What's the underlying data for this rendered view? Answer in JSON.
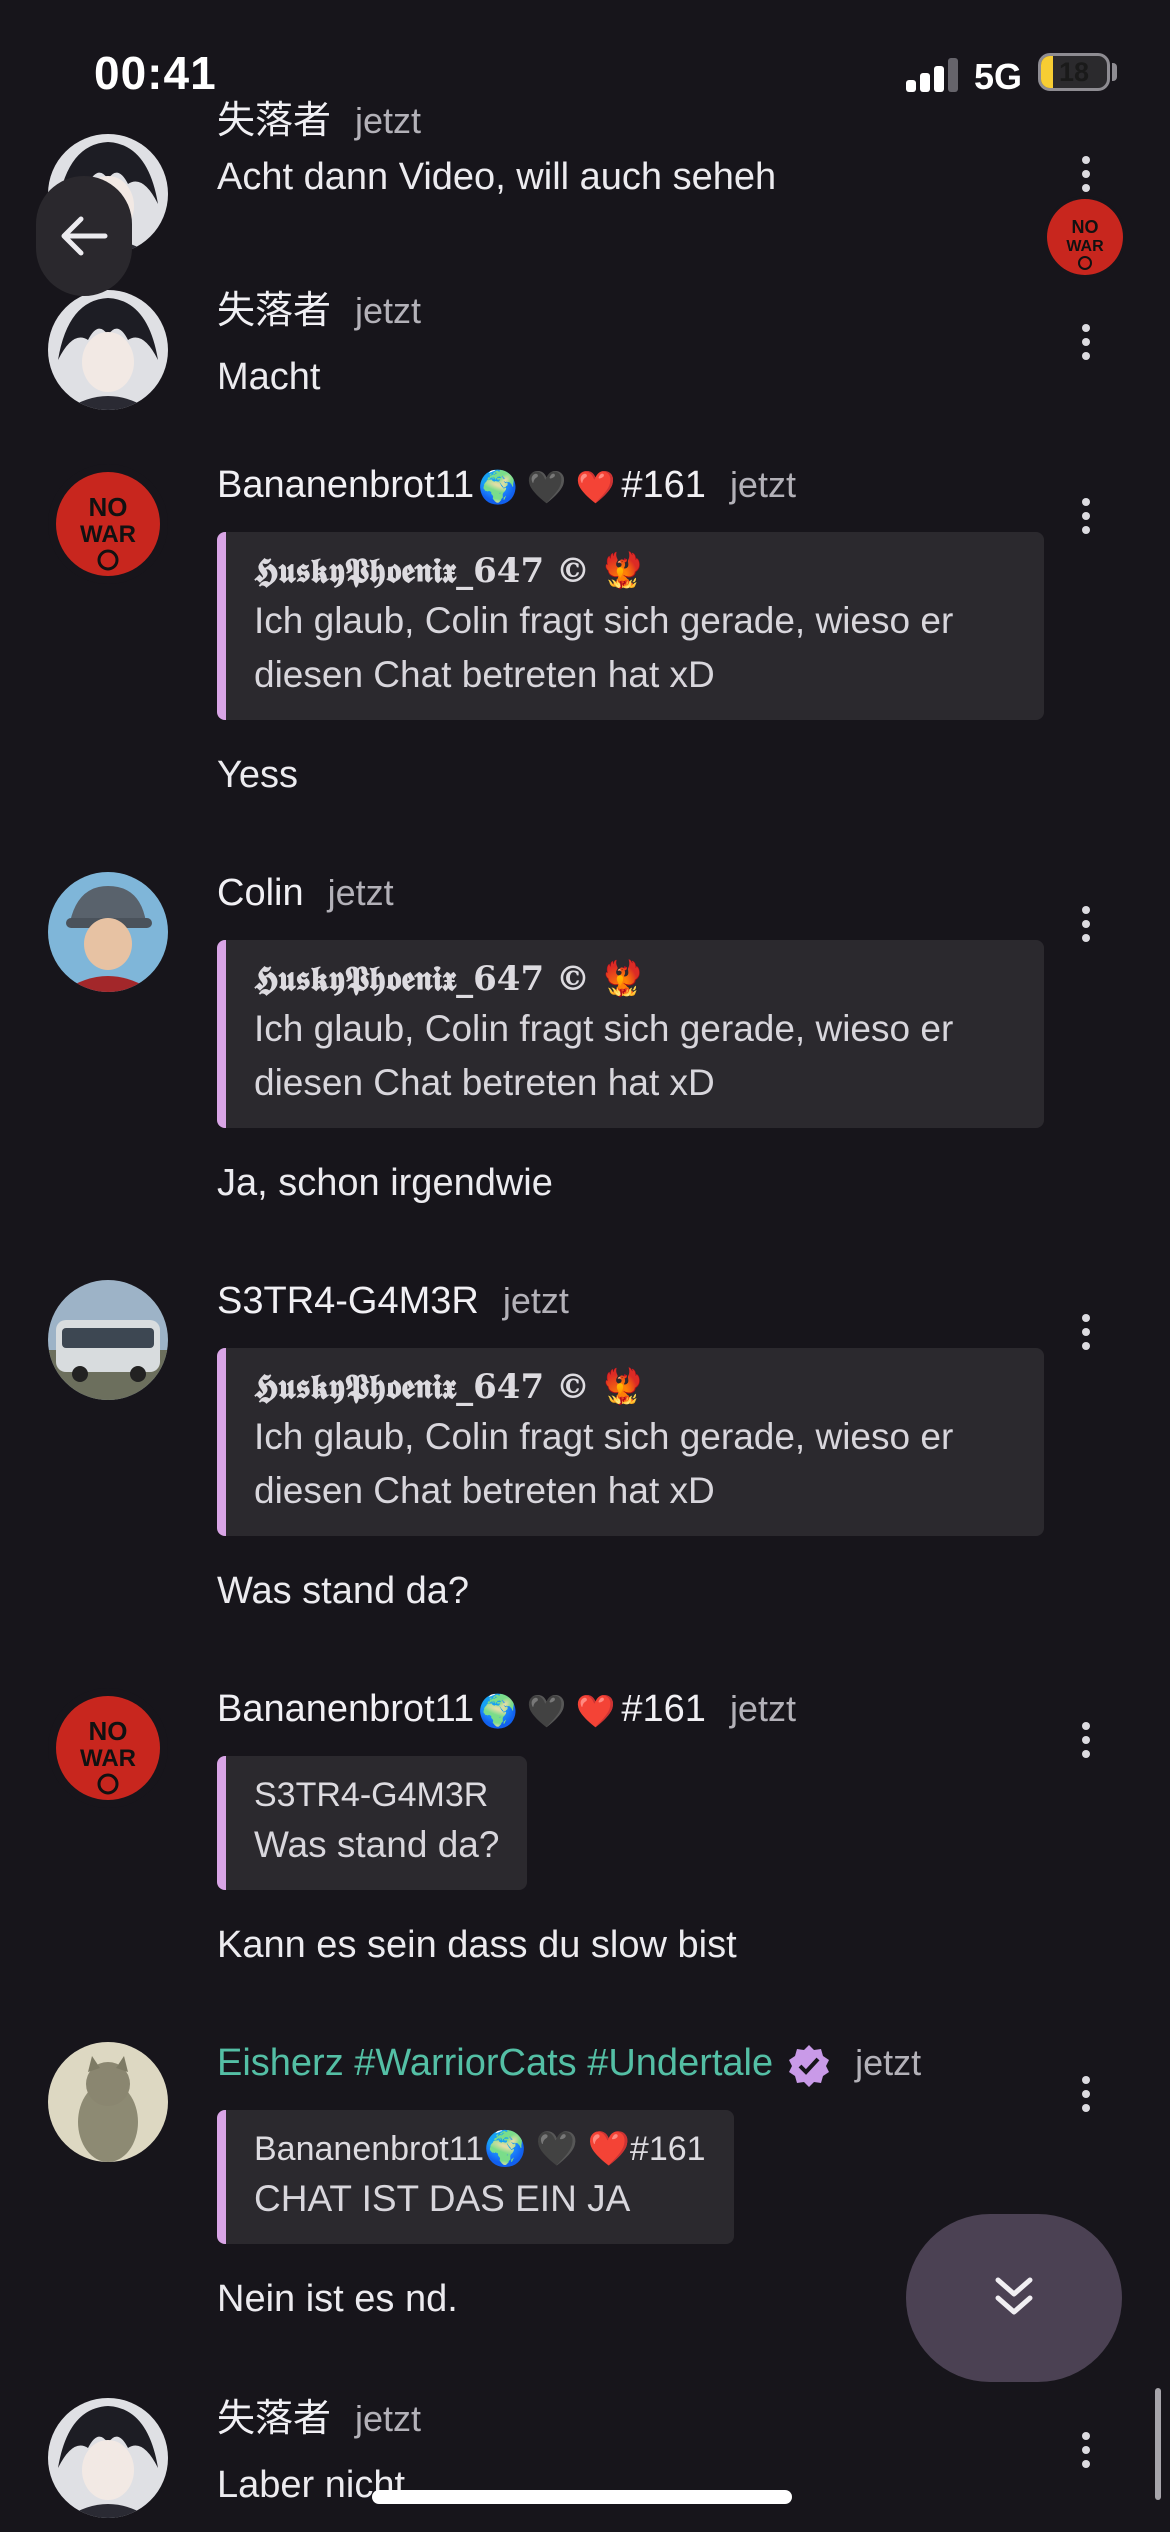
{
  "status_bar": {
    "time": "00:41",
    "network": "5G",
    "battery": "18",
    "battery_level": 0.18
  },
  "colors": {
    "background": "#17151b",
    "quote_bar": "#d9a5e6",
    "accent_name": "#54bfa5",
    "scroll_button": "#4b4153"
  },
  "icons": {
    "back": "arrow-left-icon",
    "menu": "more-vertical-icon",
    "scroll_down": "chevrons-down-icon",
    "verified": "verified-badge-icon"
  },
  "messages": [
    {
      "author": "失落者",
      "time": "jetzt",
      "text": "Acht dann Video, will auch seheh"
    },
    {
      "author": "失落者",
      "time": "jetzt",
      "text": "Macht"
    },
    {
      "author": "Bananenbrot11",
      "emojis": "🌍 🖤 ❤️",
      "tag": "#161",
      "time": "jetzt",
      "quote": {
        "author": "𝕳𝖚𝖘𝖐𝖞𝕻𝖍𝖔𝖊𝖓𝖎𝖝_647 © 🐦‍🔥",
        "text": "Ich glaub, Colin fragt sich gerade, wieso er diesen Chat betreten hat xD"
      },
      "text": "Yess"
    },
    {
      "author": "Colin",
      "time": "jetzt",
      "quote": {
        "author": "𝕳𝖚𝖘𝖐𝖞𝕻𝖍𝖔𝖊𝖓𝖎𝖝_647 © 🐦‍🔥",
        "text": "Ich glaub, Colin fragt sich gerade, wieso er diesen Chat betreten hat xD"
      },
      "text": "Ja, schon irgendwie"
    },
    {
      "author": "S3TR4-G4M3R",
      "time": "jetzt",
      "quote": {
        "author": "𝕳𝖚𝖘𝖐𝖞𝕻𝖍𝖔𝖊𝖓𝖎𝖝_647 © 🐦‍🔥",
        "text": "Ich glaub, Colin fragt sich gerade, wieso er diesen Chat betreten hat xD"
      },
      "text": "Was stand da?"
    },
    {
      "author": "Bananenbrot11",
      "emojis": "🌍 🖤 ❤️",
      "tag": "#161",
      "time": "jetzt",
      "quote": {
        "author": "S3TR4-G4M3R",
        "text": "Was stand da?"
      },
      "text": "Kann es sein dass du slow bist"
    },
    {
      "author": "Eisherz #WarriorCats #Undertale",
      "time": "jetzt",
      "quote": {
        "author": "Bananenbrot11🌍 🖤 ❤️#161",
        "text": "CHAT IST DAS EIN JA"
      },
      "text": "Nein ist es nd."
    },
    {
      "author": "失落者",
      "time": "jetzt",
      "text": "Laber nicht"
    }
  ]
}
